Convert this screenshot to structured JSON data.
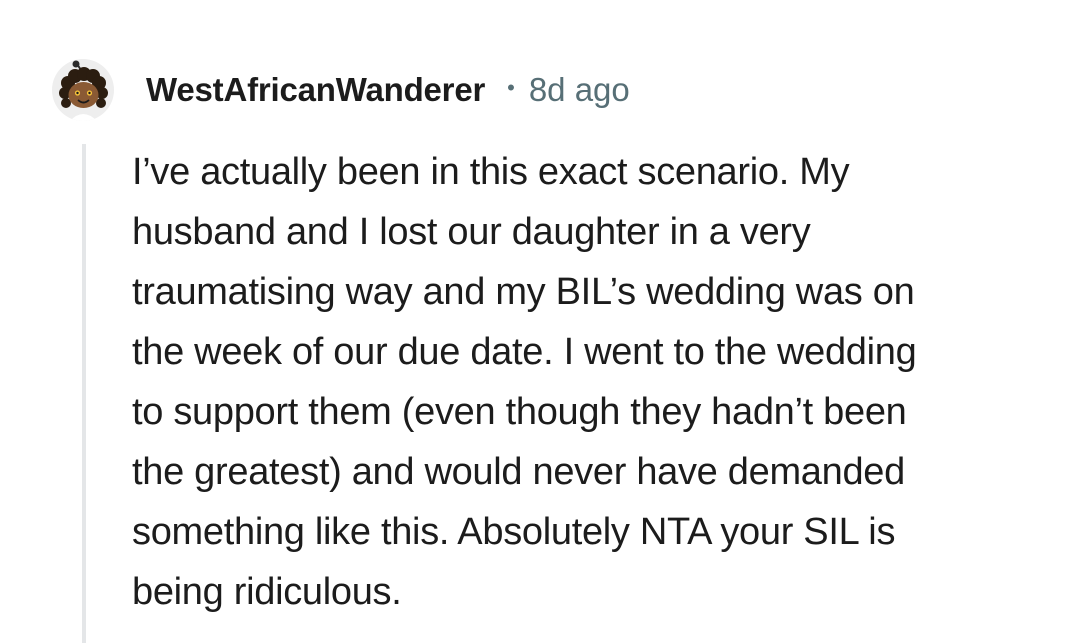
{
  "comment": {
    "author": "WestAfricanWanderer",
    "separator": "•",
    "timestamp": "8d ago",
    "avatar_icon": "snoo-avatar-icon",
    "lines": [
      "I’ve actually been in this exact scenario. My",
      "husband and I lost our daughter in a very",
      "traumatising way and my BIL’s wedding was on",
      "the week of our due date. I went to the wedding",
      "to support them (even though they hadn’t been",
      "the greatest) and would never have demanded",
      "something like this. Absolutely NTA your SIL is",
      "being ridiculous."
    ]
  },
  "colors": {
    "meta": "#576f76",
    "thread_line": "#e4e6e8",
    "text": "#1c1c1c"
  }
}
